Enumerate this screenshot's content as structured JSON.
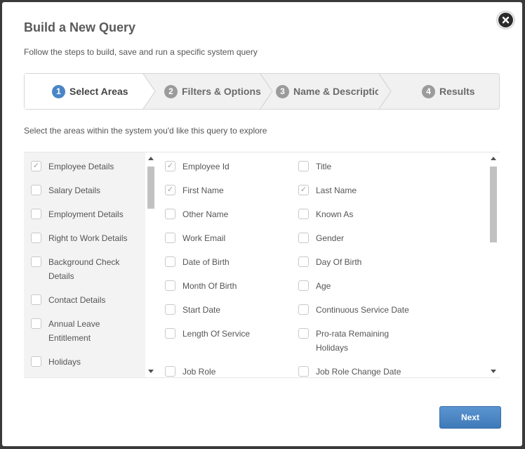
{
  "dialog": {
    "title": "Build a New Query",
    "subtitle": "Follow the steps to build, save and run a specific system query",
    "instruction": "Select the areas within the system you'd like this query to explore",
    "next_label": "Next"
  },
  "steps": [
    {
      "num": "1",
      "label": "Select Areas",
      "active": true
    },
    {
      "num": "2",
      "label": "Filters & Options",
      "active": false
    },
    {
      "num": "3",
      "label": "Name & Description",
      "active": false
    },
    {
      "num": "4",
      "label": "Results",
      "active": false
    }
  ],
  "areas": [
    {
      "label": "Employee Details",
      "checked": true
    },
    {
      "label": "Salary Details",
      "checked": false
    },
    {
      "label": "Employment Details",
      "checked": false
    },
    {
      "label": "Right to Work Details",
      "checked": false
    },
    {
      "label": "Background Check Details",
      "checked": false
    },
    {
      "label": "Contact Details",
      "checked": false
    },
    {
      "label": "Annual Leave Entitlement",
      "checked": false
    },
    {
      "label": "Holidays",
      "checked": false
    }
  ],
  "fields_col1": [
    {
      "label": "Employee Id",
      "checked": true
    },
    {
      "label": "First Name",
      "checked": true
    },
    {
      "label": "Other Name",
      "checked": false
    },
    {
      "label": "Work Email",
      "checked": false
    },
    {
      "label": "Date of Birth",
      "checked": false
    },
    {
      "label": "Month Of Birth",
      "checked": false
    },
    {
      "label": "Start Date",
      "checked": false
    },
    {
      "label": "Length Of Service",
      "checked": false
    },
    {
      "label": "Job Role",
      "checked": false
    }
  ],
  "fields_col2": [
    {
      "label": "Title",
      "checked": false
    },
    {
      "label": "Last Name",
      "checked": true
    },
    {
      "label": "Known As",
      "checked": false
    },
    {
      "label": "Gender",
      "checked": false
    },
    {
      "label": "Day Of Birth",
      "checked": false
    },
    {
      "label": "Age",
      "checked": false
    },
    {
      "label": "Continuous Service Date",
      "checked": false
    },
    {
      "label": "Pro-rata Remaining Holidays",
      "checked": false
    },
    {
      "label": "Job Role Change Date",
      "checked": false
    }
  ]
}
